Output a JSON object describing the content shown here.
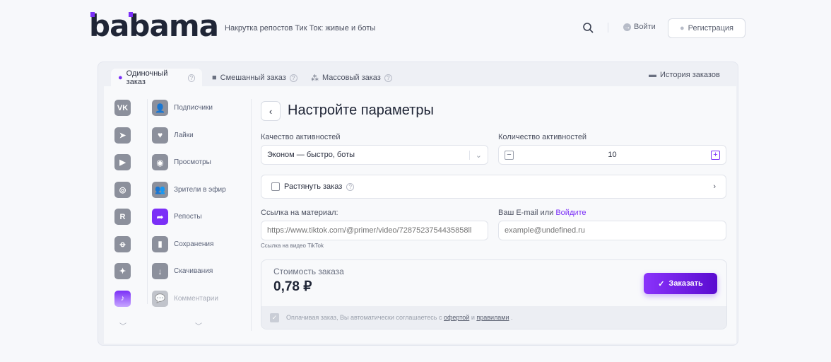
{
  "header": {
    "logo": "babama",
    "tagline": "Накрутка репостов Тик Ток: живые и боты",
    "login": "Войти",
    "register": "Регистрация"
  },
  "tabs": [
    {
      "label": "Одиночный заказ",
      "active": true
    },
    {
      "label": "Смешанный заказ"
    },
    {
      "label": "Массовый заказ"
    }
  ],
  "history": "История заказов",
  "networks": [
    {
      "icon": "vk-icon",
      "glyph": "VK"
    },
    {
      "icon": "telegram-icon",
      "glyph": "➤"
    },
    {
      "icon": "youtube-icon",
      "glyph": "▶"
    },
    {
      "icon": "instagram-icon",
      "glyph": "◎"
    },
    {
      "icon": "rutube-icon",
      "glyph": "R"
    },
    {
      "icon": "odnoklassniki-icon",
      "glyph": "ꝋ"
    },
    {
      "icon": "spark-icon",
      "glyph": "✦"
    },
    {
      "icon": "tiktok-icon",
      "glyph": "♪",
      "active": true
    }
  ],
  "services": [
    {
      "label": "Подписчики",
      "icon": "user-plus-icon",
      "glyph": "👤"
    },
    {
      "label": "Лайки",
      "icon": "heart-icon",
      "glyph": "♥"
    },
    {
      "label": "Просмотры",
      "icon": "eye-icon",
      "glyph": "◉"
    },
    {
      "label": "Зрители в эфир",
      "icon": "users-icon",
      "glyph": "👥"
    },
    {
      "label": "Репосты",
      "icon": "share-icon",
      "glyph": "➦",
      "active": true
    },
    {
      "label": "Сохранения",
      "icon": "bookmark-icon",
      "glyph": "▮"
    },
    {
      "label": "Скачивания",
      "icon": "download-icon",
      "glyph": "↓"
    },
    {
      "label": "Комментарии",
      "icon": "comment-icon",
      "glyph": "💬"
    }
  ],
  "main": {
    "title": "Настройте параметры",
    "quality_label": "Качество активностей",
    "quality_value": "Эконом — быстро, боты",
    "quantity_label": "Количество активностей",
    "quantity_value": "10",
    "stretch_label": "Растянуть заказ",
    "link_label": "Ссылка на материал:",
    "link_placeholder": "https://www.tiktok.com/@primer/video/7287523754435858ll",
    "link_hint": "Ссылка на видео TikTok",
    "email_label": "Ваш E-mail или",
    "email_login": "Войдите",
    "email_placeholder": "example@undefined.ru",
    "cost_label": "Стоимость заказа",
    "cost_value": "0,78 ₽",
    "order_button": "Заказать",
    "agree_text": "Оплачивая заказ, Вы автоматически соглашаетесь с",
    "agree_offer": "офертой",
    "agree_and": "и",
    "agree_rules": "правилами",
    "agree_end": "."
  },
  "colors": {
    "accent": "#7b2ff7"
  }
}
